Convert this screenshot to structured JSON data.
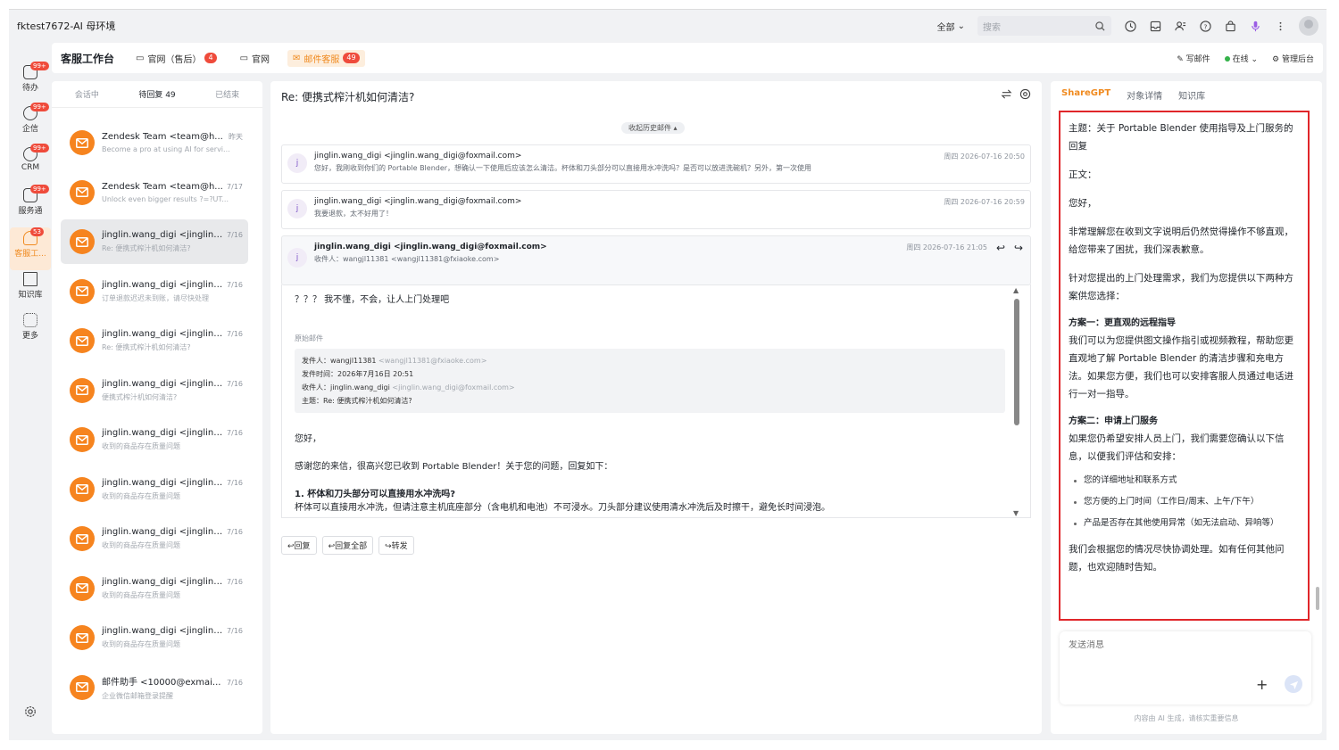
{
  "app": {
    "title": "fktest7672-AI 母环境"
  },
  "topbar": {
    "scope": "全部",
    "search_placeholder": "搜索"
  },
  "rail": [
    {
      "label": "待办",
      "badge": "99+"
    },
    {
      "label": "企信",
      "badge": "99+"
    },
    {
      "label": "CRM",
      "badge": "99+"
    },
    {
      "label": "服务通",
      "badge": "99+"
    },
    {
      "label": "客服工...",
      "badge": "53"
    },
    {
      "label": "知识库",
      "badge": ""
    },
    {
      "label": "更多",
      "badge": ""
    }
  ],
  "workspace": {
    "title": "客服工作台",
    "tabs": [
      {
        "label": "官网（售后）",
        "badge": "4"
      },
      {
        "label": "官网",
        "badge": ""
      },
      {
        "label": "邮件客服",
        "badge": "49"
      }
    ],
    "write_mail": "写邮件",
    "status": "在线",
    "admin": "管理后台"
  },
  "list": {
    "tabs": [
      "会话中",
      "待回复 49",
      "已结束"
    ],
    "items": [
      {
        "name": "Zendesk Team <team@h...",
        "time": "昨天",
        "preview": "Become a pro at using AI for servi..."
      },
      {
        "name": "Zendesk Team <team@h...",
        "time": "7/17",
        "preview": "Unlock even bigger results ?=?UT..."
      },
      {
        "name": "jinglin.wang_digi <jinglin....",
        "time": "7/16",
        "preview": "Re: 便携式榨汁机如何清洁?"
      },
      {
        "name": "jinglin.wang_digi <jinglin....",
        "time": "7/16",
        "preview": "订单退款迟迟未到账，请尽快处理"
      },
      {
        "name": "jinglin.wang_digi <jinglin....",
        "time": "7/16",
        "preview": "Re: 便携式榨汁机如何清洁?"
      },
      {
        "name": "jinglin.wang_digi <jinglin....",
        "time": "7/16",
        "preview": "便携式榨汁机如何清洁?"
      },
      {
        "name": "jinglin.wang_digi <jinglin....",
        "time": "7/16",
        "preview": "收到的商品存在质量问题"
      },
      {
        "name": "jinglin.wang_digi <jinglin....",
        "time": "7/16",
        "preview": "收到的商品存在质量问题"
      },
      {
        "name": "jinglin.wang_digi <jinglin....",
        "time": "7/16",
        "preview": "收到的商品存在质量问题"
      },
      {
        "name": "jinglin.wang_digi <jinglin....",
        "time": "7/16",
        "preview": "收到的商品存在质量问题"
      },
      {
        "name": "jinglin.wang_digi <jinglin....",
        "time": "7/16",
        "preview": "收到的商品存在质量问题"
      },
      {
        "name": "邮件助手 <10000@exmai...",
        "time": "7/16",
        "preview": "企业微信邮箱登录提醒"
      }
    ]
  },
  "mail": {
    "subject": "Re: 便携式榨汁机如何清洁?",
    "collapse_history": "收起历史邮件",
    "messages": [
      {
        "avatar": "j",
        "from": "jinglin.wang_digi <jinglin.wang_digi@foxmail.com>",
        "line2": "您好，我刚收到你们的 Portable Blender，想确认一下使用后应该怎么清洁。杯体和刀头部分可以直接用水冲洗吗？是否可以放进洗碗机？另外，第一次使用",
        "time": "周四 2026-07-16 20:50"
      },
      {
        "avatar": "j",
        "from": "jinglin.wang_digi <jinglin.wang_digi@foxmail.com>",
        "line2": "我要退款，太不好用了！",
        "time": "周四 2026-07-16 20:59"
      },
      {
        "avatar": "j",
        "from": "jinglin.wang_digi <jinglin.wang_digi@foxmail.com>",
        "line2": "收件人：wangjl11381 <wangjl11381@fxiaoke.com>",
        "time": "周四 2026-07-16 21:05"
      }
    ],
    "body": {
      "reply": "？？？ 我不懂，不会，让人上门处理吧",
      "original_label": "原始邮件",
      "orig_from_label": "发件人：",
      "orig_from_name": "wangjl11381",
      "orig_from_email": "<wangjl11381@fxiaoke.com>",
      "orig_time_label": "发件时间：",
      "orig_time": "2026年7月16日 20:51",
      "orig_to_label": "收件人：",
      "orig_to_name": "jinglin.wang_digi",
      "orig_to_email": "<jinglin.wang_digi@foxmail.com>",
      "orig_subject_label": "主题：",
      "orig_subject": "Re: 便携式榨汁机如何清洁?",
      "greeting": "您好，",
      "thanks": "感谢您的来信，很高兴您已收到 Portable Blender！关于您的问题，回复如下：",
      "q1": "1. 杯体和刀头部分可以直接用水冲洗吗?",
      "a1": "杯体可以直接用水冲洗，但请注意主机底座部分（含电机和电池）不可浸水。刀头部分建议使用清水冲洗后及时擦干，避免长时间浸泡。"
    },
    "actions": {
      "reply": "回复",
      "reply_all": "回复全部",
      "forward": "转发"
    }
  },
  "ai": {
    "tabs": [
      "ShareGPT",
      "对象详情",
      "知识库"
    ],
    "subject": "主题：关于 Portable Blender 使用指导及上门服务的回复",
    "body_label": "正文：",
    "greeting": "您好，",
    "p1": "非常理解您在收到文字说明后仍然觉得操作不够直观，给您带来了困扰，我们深表歉意。",
    "p2": "针对您提出的上门处理需求，我们为您提供以下两种方案供您选择：",
    "opt1_title": "方案一：更直观的远程指导",
    "opt1_body": "我们可以为您提供图文操作指引或视频教程，帮助您更直观地了解 Portable Blender 的清洁步骤和充电方法。如果您方便，我们也可以安排客服人员通过电话进行一对一指导。",
    "opt2_title": "方案二：申请上门服务",
    "opt2_body": "如果您仍希望安排人员上门，我们需要您确认以下信息，以便我们评估和安排：",
    "bullets": [
      "您的详细地址和联系方式",
      "您方便的上门时间（工作日/周末、上午/下午）",
      "产品是否存在其他使用异常（如无法启动、异响等）"
    ],
    "closing": "我们会根据您的情况尽快协调处理。如有任何其他问题，也欢迎随时告知。",
    "input_placeholder": "发送消息",
    "disclaimer": "内容由 AI 生成，请核实重要信息"
  }
}
